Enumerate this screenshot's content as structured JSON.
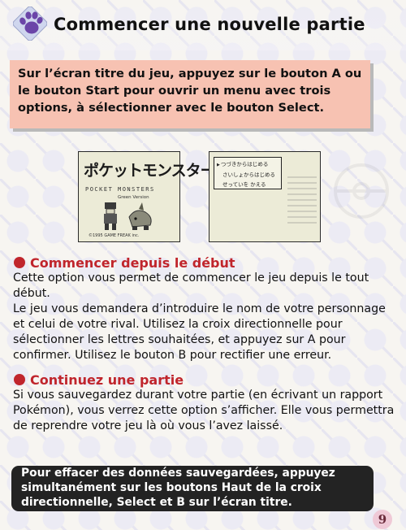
{
  "header": {
    "icon": "paw-print-icon",
    "title": "Commencer une nouvelle partie"
  },
  "intro": {
    "text": "Sur l’écran titre du jeu, appuyez sur le bouton A ou le bouton Start pour ouvrir un menu avec trois options, à sélectionner avec le bouton Select."
  },
  "screenshots": {
    "title_screen": {
      "logo": "ポケットモンスター",
      "subtitle": "POCKET MONSTERS",
      "version": "Green Version",
      "copyright": "©1995 GAME FREAK inc."
    },
    "menu_screen": {
      "options": [
        "つづきからはじめる",
        "さいしょからはじめる",
        "せっていを かえる"
      ]
    }
  },
  "sections": [
    {
      "heading": "Commencer depuis le début",
      "paragraphs": [
        "Cette option vous permet de commencer le jeu depuis le tout début.",
        "Le jeu vous demandera d’introduire le nom de votre personnage et celui de votre rival. Utilisez la croix directionnelle pour sélectionner les lettres souhaitées, et appuyez sur A pour confirmer. Utilisez le bouton B pour rectifier une erreur."
      ]
    },
    {
      "heading": "Continuez une partie",
      "paragraphs": [
        "Si vous sauvegardez durant votre partie (en écrivant un rapport Pokémon), vous verrez cette option s’afficher. Elle vous permettra de reprendre votre jeu là où vous l’avez laissé."
      ]
    }
  ],
  "note": {
    "text": "Pour effacer des données sauvegardées, appuyez simultanément sur les boutons Haut de la croix directionnelle, Select et B sur l’écran titre."
  },
  "page_number": "9",
  "colors": {
    "accent_red": "#c0252c",
    "intro_box": "#f7c2b2",
    "note_box": "#232323",
    "paw_purple": "#6b45a8"
  }
}
